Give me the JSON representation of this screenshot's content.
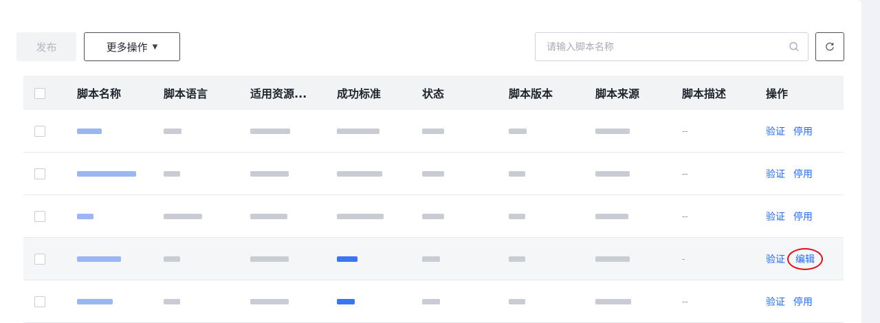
{
  "toolbar": {
    "publish_label": "发布",
    "more_actions_label": "更多操作",
    "search_placeholder": "请输入脚本名称"
  },
  "table": {
    "headers": [
      "脚本名称",
      "脚本语言",
      "适用资源...",
      "成功标准",
      "状态",
      "脚本版本",
      "脚本来源",
      "脚本描述",
      "操作"
    ],
    "rows": [
      {
        "desc": "--",
        "actions": [
          "验证",
          "停用"
        ]
      },
      {
        "desc": "--",
        "actions": [
          "验证",
          "停用"
        ]
      },
      {
        "desc": "--",
        "actions": [
          "验证",
          "停用"
        ]
      },
      {
        "desc": "-",
        "actions": [
          "验证",
          "编辑"
        ]
      },
      {
        "desc": "--",
        "actions": [
          "验证",
          "停用"
        ]
      }
    ]
  },
  "colors": {
    "link": "#1f6bff",
    "annotation_circle": "#e0101a"
  },
  "icons": {
    "search": "search-icon",
    "refresh": "refresh-icon",
    "dropdown": "caret-down-icon"
  }
}
